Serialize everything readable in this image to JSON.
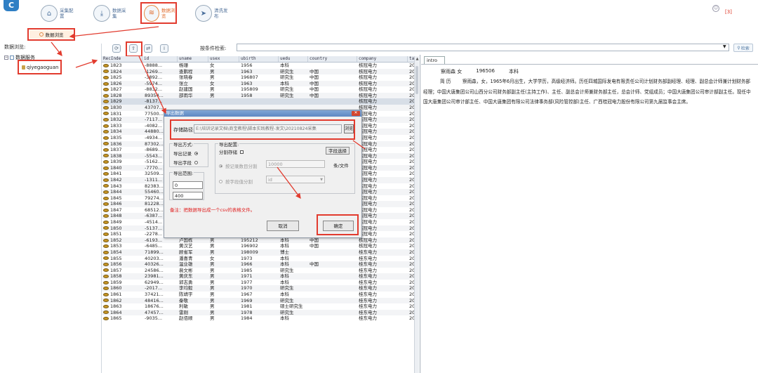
{
  "toolbar": {
    "logo": "C",
    "buttons": [
      {
        "label": "采集配置",
        "icon": "home-icon"
      },
      {
        "label": "数据采集",
        "icon": "download-icon"
      },
      {
        "label": "数据浏览",
        "icon": "layers-icon"
      },
      {
        "label": "清洗发布",
        "icon": "send-icon"
      }
    ],
    "counter": "[3]"
  },
  "browse_tab": "数据浏览",
  "left_panel": {
    "title": "数据浏览:",
    "tree_root": "数据服务",
    "tree_child": "qiyegaoguan"
  },
  "search": {
    "label": "按条件检索:",
    "placeholder": "",
    "button": "检索"
  },
  "grid": {
    "columns": [
      "RecInde",
      "id",
      "uname",
      "usex",
      "ubirth",
      "uedu",
      "country",
      "company",
      "tas"
    ],
    "rows": [
      [
        "1823",
        "-8888...",
        "杨珊",
        "女",
        "1956",
        "本科",
        "",
        "核冠电力",
        "202"
      ],
      [
        "1824",
        "-1269...",
        "查鹏程",
        "男",
        "1963",
        "研究生",
        "中国",
        "核冠电力",
        "202"
      ],
      [
        "1825",
        "-3892...",
        "张晓春",
        "男",
        "196807",
        "研究生",
        "中国",
        "核冠电力",
        "202"
      ],
      [
        "1826",
        "-5974...",
        "张立",
        "女",
        "1963",
        "本科",
        "中国",
        "核冠电力",
        "202"
      ],
      [
        "1827",
        "-8832...",
        "赵建国",
        "男",
        "195809",
        "研究生",
        "中国",
        "核冠电力",
        "202"
      ],
      [
        "1828",
        "89354...",
        "邵雨华",
        "男",
        "1958",
        "研究生",
        "中国",
        "核冠电力",
        "202"
      ],
      [
        "1829",
        "-8137...",
        "",
        "",
        "",
        "",
        "",
        "核冠电力",
        "202"
      ],
      [
        "1830",
        "43707...",
        "",
        "",
        "",
        "",
        "",
        "核冠电力",
        "202"
      ],
      [
        "1831",
        "77500...",
        "",
        "",
        "",
        "",
        "",
        "核冠电力",
        "202"
      ],
      [
        "1832",
        "-7117...",
        "",
        "",
        "",
        "",
        "",
        "核冠电力",
        "202"
      ],
      [
        "1833",
        "-4082...",
        "",
        "",
        "",
        "",
        "",
        "核冠电力",
        "202"
      ],
      [
        "1834",
        "44880...",
        "",
        "",
        "",
        "",
        "",
        "核冠电力",
        "202"
      ],
      [
        "1835",
        "-4934...",
        "",
        "",
        "",
        "",
        "",
        "核冠电力",
        "202"
      ],
      [
        "1836",
        "87302...",
        "",
        "",
        "",
        "",
        "",
        "核冠电力",
        "202"
      ],
      [
        "1837",
        "-8689...",
        "",
        "",
        "",
        "",
        "",
        "核冠电力",
        "202"
      ],
      [
        "1838",
        "-5543...",
        "",
        "",
        "",
        "",
        "",
        "核冠电力",
        "202"
      ],
      [
        "1839",
        "-5162...",
        "",
        "",
        "",
        "",
        "",
        "核冠电力",
        "202"
      ],
      [
        "1840",
        "-7770...",
        "",
        "",
        "",
        "",
        "",
        "核冠电力",
        "202"
      ],
      [
        "1841",
        "32509...",
        "",
        "",
        "",
        "",
        "",
        "核冠电力",
        "202"
      ],
      [
        "1842",
        "-1311...",
        "",
        "",
        "",
        "",
        "",
        "核冠电力",
        "202"
      ],
      [
        "1843",
        "82383...",
        "",
        "",
        "",
        "",
        "",
        "核冠电力",
        "202"
      ],
      [
        "1844",
        "55460...",
        "",
        "",
        "",
        "",
        "",
        "核冠电力",
        "202"
      ],
      [
        "1845",
        "79274...",
        "",
        "",
        "",
        "",
        "",
        "核冠电力",
        "202"
      ],
      [
        "1846",
        "81228...",
        "",
        "",
        "",
        "",
        "",
        "核冠电力",
        "202"
      ],
      [
        "1847",
        "68512...",
        "",
        "",
        "",
        "",
        "",
        "核冠电力",
        "202"
      ],
      [
        "1848",
        "-6387...",
        "黄新春",
        "男",
        "196209",
        "本科",
        "中国",
        "核冠电力",
        "202"
      ],
      [
        "1849",
        "-4514...",
        "洗宁",
        "女",
        "195602",
        "大专",
        "中国",
        "核冠电力",
        "202"
      ],
      [
        "1850",
        "-5137...",
        "黄建平",
        "男",
        "195301",
        "本科",
        "中国",
        "核冠电力",
        "202"
      ],
      [
        "1851",
        "-2278...",
        "陈胜利",
        "男",
        "196006",
        "研究生",
        "中国",
        "核冠电力",
        "202"
      ],
      [
        "1852",
        "-6193...",
        "卢国栋",
        "男",
        "195212",
        "本科",
        "中国",
        "核冠电力",
        "202"
      ],
      [
        "1853",
        "-6485...",
        "黄汉艺",
        "男",
        "196902",
        "本科",
        "中国",
        "核冠电力",
        "202"
      ],
      [
        "1854",
        "71899...",
        "顾省军",
        "男",
        "198009",
        "博士",
        "",
        "桂东电力",
        "202"
      ],
      [
        "1855",
        "40203...",
        "潘喜青",
        "女",
        "1973",
        "本科",
        "",
        "桂东电力",
        "202"
      ],
      [
        "1856",
        "40326...",
        "温业雄",
        "男",
        "1966",
        "本科",
        "中国",
        "桂东电力",
        "202"
      ],
      [
        "1857",
        "24586...",
        "裴文彬",
        "男",
        "1985",
        "研究生",
        "",
        "桂东电力",
        "202"
      ],
      [
        "1858",
        "23981...",
        "黄庆东",
        "男",
        "1971",
        "本科",
        "",
        "桂东电力",
        "202"
      ],
      [
        "1859",
        "62949...",
        "郭志勇",
        "男",
        "1977",
        "本科",
        "",
        "桂东电力",
        "202"
      ],
      [
        "1860",
        "-2017...",
        "李均毅",
        "男",
        "1970",
        "研究生",
        "",
        "桂东电力",
        "202"
      ],
      [
        "1861",
        "37421...",
        "陈靖宇",
        "男",
        "1967",
        "本科",
        "",
        "桂东电力",
        "202"
      ],
      [
        "1862",
        "48416...",
        "秦敬",
        "男",
        "1969",
        "研究生",
        "",
        "桂东电力",
        "202"
      ],
      [
        "1863",
        "18676...",
        "利敏",
        "男",
        "1981",
        "硕士研究生",
        "",
        "桂东电力",
        "202"
      ],
      [
        "1864",
        "47457...",
        "雷刚",
        "男",
        "1978",
        "研究生",
        "",
        "桂东电力",
        "202"
      ],
      [
        "1865",
        "-9035...",
        "赵佰顺",
        "男",
        "1984",
        "本科",
        "",
        "桂东电力",
        "202"
      ]
    ]
  },
  "intro": {
    "tab": "intro",
    "name": "察雨森",
    "sex": "女",
    "birth": "196506",
    "edu": "本科",
    "label": "简 历",
    "resume": "察雨森，女，1965年6月出生，大学学历，高级经济师。历任四城国际发电有限责任公司计划财务部副经理、经理、副总会计师兼计划财务部经理；中国大唐集团公司山西分公司财务部副主任(主持工作)、主任、副总会计师兼财务部主任，总会计师、党组成员；中国大唐集团公司审计部副主任。现任中国大唐集团公司审计部主任、中国大唐集团有限公司法律事务部(风险管控部)主任、广西桂冠电力股份有限公司第九届监事会主席。"
  },
  "dialog": {
    "title": "导出数据",
    "path_label": "存储路径:",
    "path_value": "E:\\培训记录文档\\商宝教程\\脚本实践教程-发文\\20210824采集",
    "browse": "浏览",
    "mode_title": "导出方式:",
    "mode_records": "导出记录",
    "mode_fields": "导出字段",
    "range_title": "导出范围:",
    "range_from": "0",
    "range_to": "400",
    "config_title": "导出配置:",
    "split_label": "分割存储",
    "field_select_btn": "字段选择",
    "by_count": "按记录数目分割",
    "count_value": "10000",
    "count_unit": "条/文件",
    "by_field": "按字段值分割",
    "field_value": "id",
    "note": "备注：把数据导出成一个csv的表格文件。",
    "cancel": "取消",
    "ok": "确定"
  }
}
